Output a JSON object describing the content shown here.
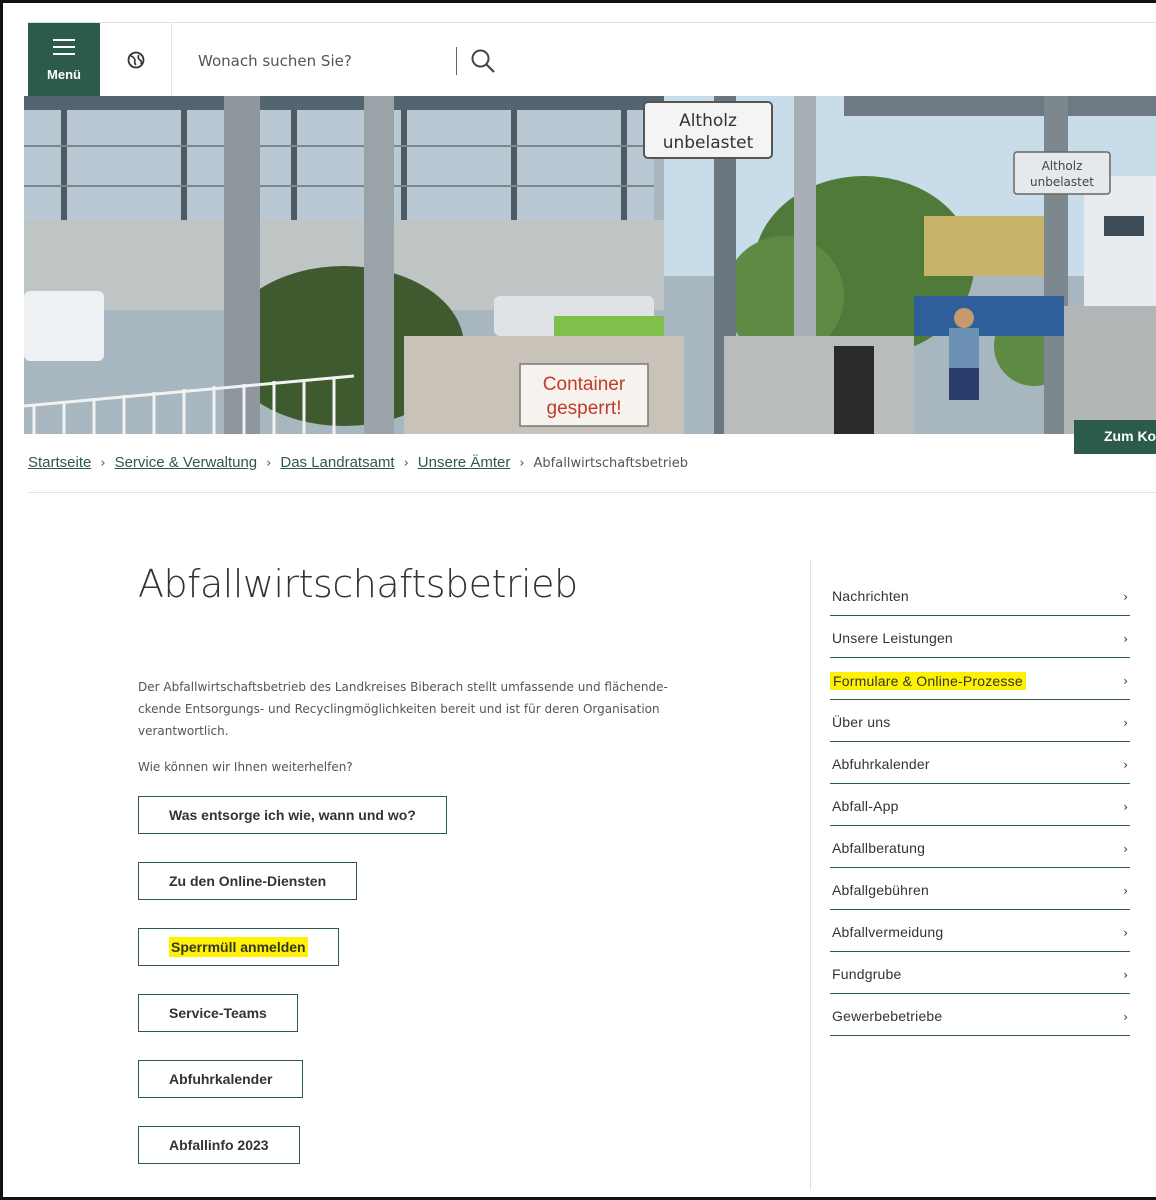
{
  "header": {
    "menu_label": "Menü",
    "search_placeholder": "Wonach suchen Sie?",
    "icons": [
      "menu-icon",
      "globe-icon",
      "search-icon"
    ]
  },
  "hero": {
    "sign_left": "Altholz\nunbelastet",
    "sign_right": "Altholz\nunbelastet",
    "sign_container": "Container\ngesperrt!",
    "zum_button": "Zum Kontakt"
  },
  "breadcrumb": {
    "items": [
      "Startseite",
      "Service & Verwaltung",
      "Das Landratsamt",
      "Unsere Ämter"
    ],
    "current": "Abfallwirtschaftsbetrieb"
  },
  "main": {
    "title": "Abfallwirtschaftsbetrieb",
    "intro_line1": "Der Abfallwirtschaftsbetrieb des Landkreises Biberach stellt umfassende und  flächende-",
    "intro_line2": "ckende Entsorgungs- und Recyclingmöglichkeiten bereit und ist für deren Organisation",
    "intro_line3": "verantwortlich.",
    "question": "Wie können wir Ihnen weiterhelfen?",
    "buttons": [
      "Was entsorge ich wie, wann und wo?",
      "Zu den Online-Diensten",
      "Sperrmüll anmelden",
      "Service-Teams",
      "Abfuhrkalender",
      "Abfallinfo 2023"
    ]
  },
  "sidebar": {
    "items": [
      "Nachrichten",
      "Unsere Leistungen",
      "Formulare & Online-Prozesse",
      "Über uns",
      "Abfuhrkalender",
      "Abfall-App",
      "Abfallberatung",
      "Abfallgebühren",
      "Abfallvermeidung",
      "Fundgrube",
      "Gewerbebetriebe"
    ],
    "chevron": "›"
  },
  "colors": {
    "brand_green": "#2c5a4c",
    "highlight": "#fff200"
  }
}
